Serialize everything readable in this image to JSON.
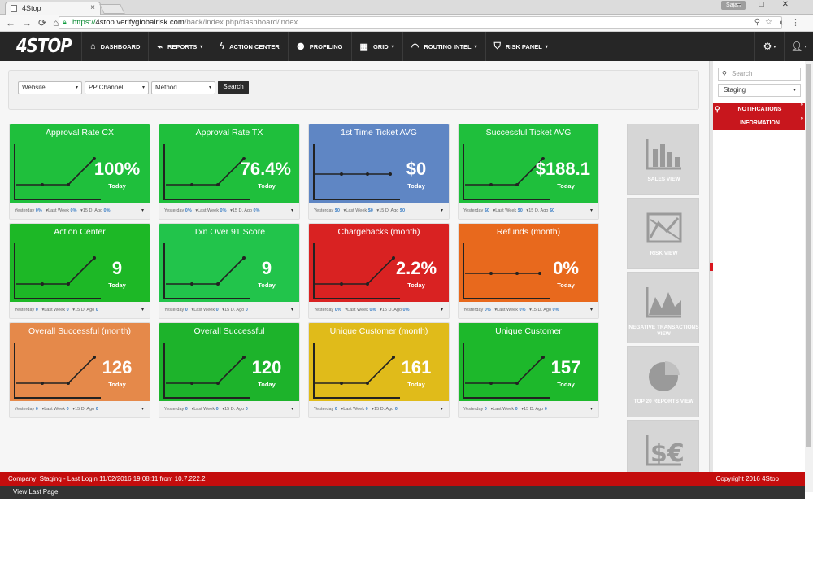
{
  "browser": {
    "tab_title": "4Stop",
    "user_chip": "Sajan",
    "url_scheme": "https://",
    "url_host": "4stop.verifyglobalrisk.com",
    "url_path": "/back/index.php/dashboard/index"
  },
  "nav": {
    "logo": "4STOP",
    "items": [
      {
        "label": "DASHBOARD",
        "icon": "home-icon",
        "caret": false
      },
      {
        "label": "REPORTS",
        "icon": "chart-icon",
        "caret": true
      },
      {
        "label": "ACTION CENTER",
        "icon": "bolt-icon",
        "caret": false
      },
      {
        "label": "PROFILING",
        "icon": "users-icon",
        "caret": false
      },
      {
        "label": "GRID",
        "icon": "grid-icon",
        "caret": true
      },
      {
        "label": "ROUTING INTEL",
        "icon": "wifi-icon",
        "caret": true
      },
      {
        "label": "RISK PANEL",
        "icon": "shield-icon",
        "caret": true
      }
    ]
  },
  "filters": {
    "website": "Website",
    "channel": "PP Channel",
    "method": "Method",
    "search_label": "Search"
  },
  "footer_labels": {
    "yesterday": "Yesterday",
    "last_week": "Last Week",
    "fifteen": "15 D. Ago"
  },
  "tiles": [
    {
      "title": "Approval Rate CX",
      "value": "100%",
      "today": "Today",
      "color": "#1fbf3c",
      "y": "0%",
      "w": "0%",
      "d": "0%"
    },
    {
      "title": "Approval Rate TX",
      "value": "76.4%",
      "today": "Today",
      "color": "#1fbf3c",
      "y": "0%",
      "w": "0%",
      "d": "0%"
    },
    {
      "title": "1st Time Ticket AVG",
      "value": "$0",
      "today": "Today",
      "color": "#5f86c4",
      "y": "$0",
      "w": "$0",
      "d": "$0"
    },
    {
      "title": "Successful Ticket AVG",
      "value": "$188.1",
      "today": "Today",
      "color": "#1fbf3c",
      "y": "$0",
      "w": "$0",
      "d": "$0"
    },
    {
      "title": "Action Center",
      "value": "9",
      "today": "Today",
      "color": "#1db826",
      "y": "0",
      "w": "0",
      "d": "0"
    },
    {
      "title": "Txn Over 91 Score",
      "value": "9",
      "today": "Today",
      "color": "#22c44b",
      "y": "0",
      "w": "0",
      "d": "0"
    },
    {
      "title": "Chargebacks (month)",
      "value": "2.2%",
      "today": "Today",
      "color": "#d92222",
      "y": "0%",
      "w": "0%",
      "d": "0%"
    },
    {
      "title": "Refunds (month)",
      "value": "0%",
      "today": "Today",
      "color": "#e8691d",
      "y": "0%",
      "w": "0%",
      "d": "0%"
    },
    {
      "title": "Overall Successful (month)",
      "value": "126",
      "today": "Today",
      "color": "#e5894a",
      "y": "0",
      "w": "0",
      "d": "0"
    },
    {
      "title": "Overall Successful",
      "value": "120",
      "today": "Today",
      "color": "#1db32b",
      "y": "0",
      "w": "0",
      "d": "0"
    },
    {
      "title": "Unique Customer (month)",
      "value": "161",
      "today": "Today",
      "color": "#e0bb1a",
      "y": "0",
      "w": "0",
      "d": "0"
    },
    {
      "title": "Unique Customer",
      "value": "157",
      "today": "Today",
      "color": "#1db82b",
      "y": "0",
      "w": "0",
      "d": "0"
    }
  ],
  "views": [
    {
      "label": "SALES VIEW",
      "icon": "bar-chart-icon"
    },
    {
      "label": "RISK VIEW",
      "icon": "risk-chart-icon"
    },
    {
      "label": "NEGATIVE TRANSACTIONS VIEW",
      "icon": "mountain-chart-icon"
    },
    {
      "label": "TOP 20 REPORTS VIEW",
      "icon": "pie-chart-icon"
    },
    {
      "label": "",
      "icon": "currency-icon"
    }
  ],
  "rpanel": {
    "search_placeholder": "Search",
    "company_select": "Staging",
    "notifications": "NOTIFICATIONS",
    "information": "INFORMATION"
  },
  "footer": {
    "status": "Company: Staging - Last Login 11/02/2016 19:08:11 from 10.7.222.2",
    "copyright": "Copyright 2016 4Stop",
    "view_last_page": "View Last Page"
  }
}
